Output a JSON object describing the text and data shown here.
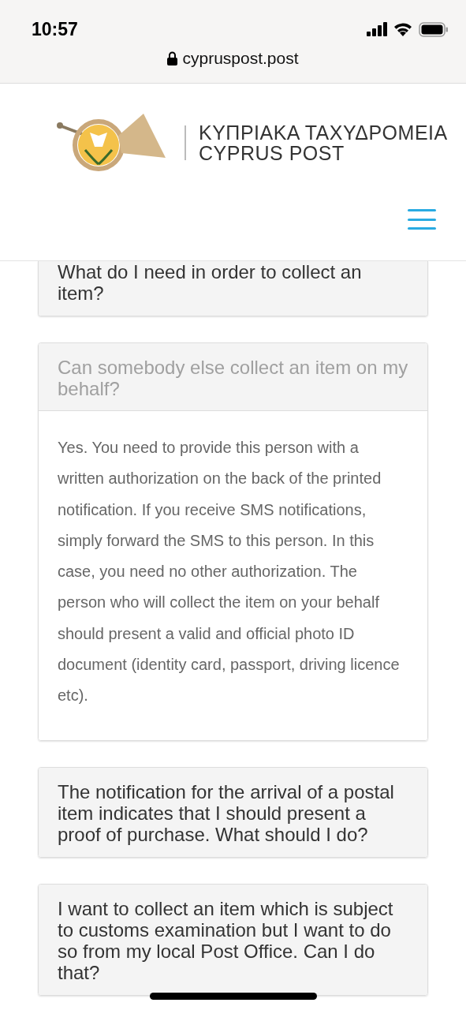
{
  "status_bar": {
    "time": "10:57"
  },
  "address_bar": {
    "url": "cypruspost.post"
  },
  "header": {
    "logo_title": "ΚΥΠΡΙΑΚΑ ΤΑΧΥΔΡΟΜΕΙΑ",
    "logo_subtitle": "CYPRUS POST"
  },
  "faq": [
    {
      "question": "What do I need in order to collect an item?",
      "expanded": false
    },
    {
      "question": "Can somebody else collect an item on my behalf?",
      "expanded": true,
      "answer": "Yes. You need to provide this person with a written authorization on the back of the printed notification. If you receive SMS notifications, simply forward the SMS to this person. In this case, you need no other authorization. The person who will collect the item on your behalf should present a valid and official photo ID document (identity card, passport, driving licence etc)."
    },
    {
      "question": "The notification for the arrival of a postal item indicates that I should present a proof of purchase. What should I do?",
      "expanded": false
    },
    {
      "question": "I want to collect an item which is subject to customs examination but I want to do so from my local Post Office. Can I do that?",
      "expanded": false
    }
  ]
}
